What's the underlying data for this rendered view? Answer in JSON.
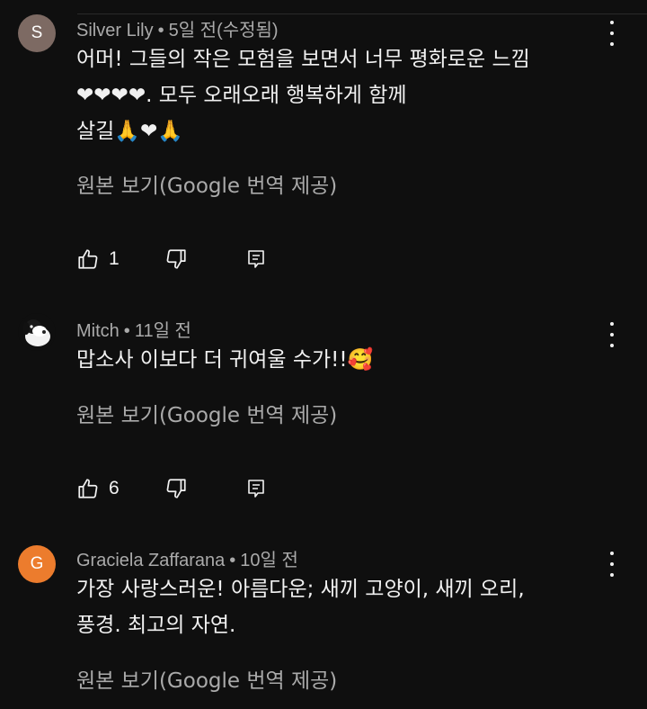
{
  "comments": [
    {
      "avatar_letter": "S",
      "avatar_color": "#7d6a63",
      "author": "Silver Lily",
      "separator": "•",
      "time": "5일 전(수정됨)",
      "text": "어머! 그들의 작은 모험을 보면서 너무 평화로운 느낌\n❤❤❤❤. 모두 오래오래 행복하게 함께\n살길🙏❤🙏",
      "translate_label": "원본 보기(Google 번역 제공)",
      "likes": "1"
    },
    {
      "avatar_letter": "",
      "avatar_icon": "dog-avatar-icon",
      "author": "Mitch",
      "separator": "•",
      "time": "11일 전",
      "text": "맙소사 이보다 더 귀여울 수가!!🥰",
      "translate_label": "원본 보기(Google 번역 제공)",
      "likes": "6"
    },
    {
      "avatar_letter": "G",
      "avatar_color": "#ec7c2d",
      "author": "Graciela Zaffarana",
      "separator": "•",
      "time": "10일 전",
      "text": "가장 사랑스러운! 아름다운; 새끼 고양이, 새끼 오리,\n풍경. 최고의 자연.",
      "translate_label": "원본 보기(Google 번역 제공)"
    }
  ]
}
